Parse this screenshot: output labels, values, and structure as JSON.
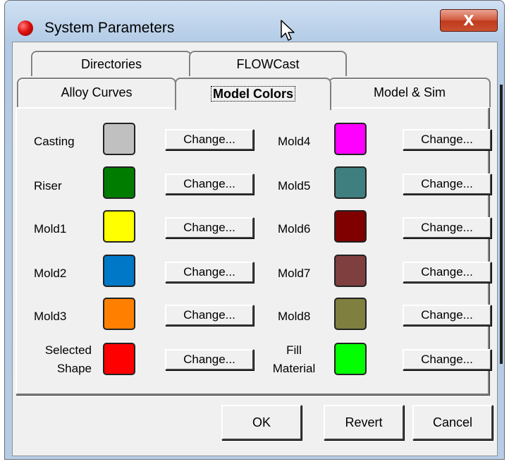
{
  "window": {
    "title": "System Parameters",
    "close_label": "X"
  },
  "tabs": {
    "row1": [
      "Directories",
      "FLOWCast"
    ],
    "row2": [
      "Alloy Curves",
      "Model Colors",
      "Model & Sim"
    ],
    "active": "Model Colors"
  },
  "colors": {
    "left": [
      {
        "label": "Casting",
        "color": "#c0c0c0",
        "button": "Change..."
      },
      {
        "label": "Riser",
        "color": "#007d00",
        "button": "Change..."
      },
      {
        "label": "Mold1",
        "color": "#ffff00",
        "button": "Change..."
      },
      {
        "label": "Mold2",
        "color": "#0078c8",
        "button": "Change..."
      },
      {
        "label": "Mold3",
        "color": "#ff8000",
        "button": "Change..."
      },
      {
        "label_line1": "Selected",
        "label_line2": "Shape",
        "color": "#ff0000",
        "button": "Change..."
      }
    ],
    "right": [
      {
        "label": "Mold4",
        "color": "#ff00ff",
        "button": "Change..."
      },
      {
        "label": "Mold5",
        "color": "#3f7f7f",
        "button": "Change..."
      },
      {
        "label": "Mold6",
        "color": "#800000",
        "button": "Change..."
      },
      {
        "label": "Mold7",
        "color": "#7f3f3f",
        "button": "Change..."
      },
      {
        "label": "Mold8",
        "color": "#7f7f3f",
        "button": "Change..."
      },
      {
        "label_line1": "Fill",
        "label_line2": "Material",
        "color": "#00ff00",
        "button": "Change..."
      }
    ]
  },
  "buttons": {
    "ok": "OK",
    "revert": "Revert",
    "cancel": "Cancel"
  }
}
